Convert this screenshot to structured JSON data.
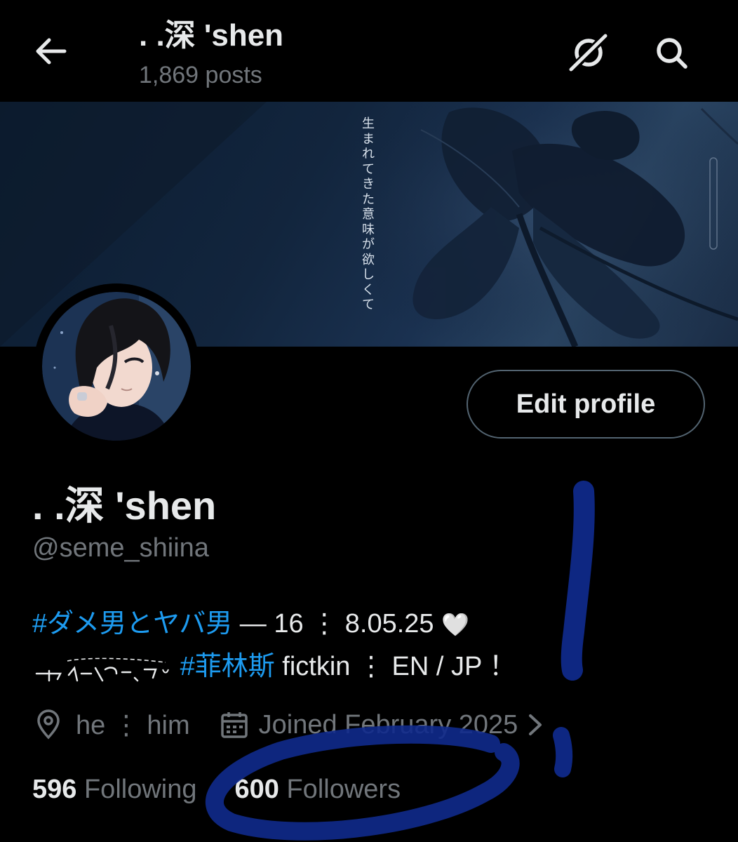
{
  "header": {
    "title": ". .深 'shen",
    "post_count": "1,869 posts"
  },
  "banner": {
    "vertical_text": "生まれてきた意味が欲しくて"
  },
  "edit_profile_label": "Edit profile",
  "profile": {
    "display_name": ". .深 'shen",
    "handle": "@seme_shiina",
    "bio": {
      "hashtag1": "#ダメ男とヤバ男",
      "line1_rest": " — 16 ⋮ 8.05.25 ",
      "heart": "🤍",
      "hashtag2": "#菲林斯",
      "line2_rest": " fictkin ⋮ EN / JP ！"
    },
    "location": "he ⋮ him",
    "joined": "Joined February 2025",
    "following_count": "596",
    "following_label": "Following",
    "followers_count": "600",
    "followers_label": "Followers"
  },
  "colors": {
    "accent": "#1d9bf0",
    "text": "#e7e9ea",
    "muted": "#71767b",
    "scribble": "#0f2a8c"
  }
}
